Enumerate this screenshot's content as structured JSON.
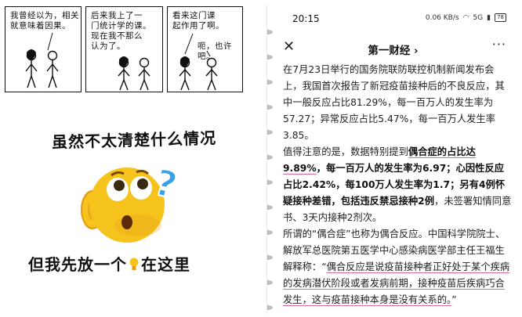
{
  "comic": {
    "panel1_line1": "我曾经以为，相关",
    "panel1_line2": "就意味着因果。",
    "panel2_line1": "后来我上了一",
    "panel2_line2": "门统计学的课。",
    "panel2_line3": "现在我不那么",
    "panel2_line4": "认为了。",
    "panel3_line1": "看来这门课",
    "panel3_line2": "起作用了啊。",
    "panel3_reply": "呃，也许吧。"
  },
  "meme": {
    "caption_top": "虽然不太清楚什么情况",
    "caption_bottom_a": "但我先放一个",
    "caption_bottom_b": "在这里"
  },
  "phone": {
    "status": {
      "time": "20:15",
      "speed": "0.06 KB/s",
      "signal": "5G",
      "battery": "78"
    },
    "nav": {
      "close_icon": "close-icon",
      "title": "第一财经 ›",
      "more": "···"
    },
    "article": {
      "p1": "在7月23日举行的国务院联防联控机制新闻发布会上，我国首次报告了新冠疫苗接种后的不良反应，其中一般反应占比81.29%，每一百万人的发生率为57.27；异常反应占比5.47%，每一百万人发生率3.85。",
      "p2_a": "值得注意的是，数据特别提到",
      "p2_b": "偶合症的占比达9.89%",
      "p2_c": "，每一百万人的发生率为6.97；心因性反应占比2.42%，每100万人发生率为1.7；另有4例怀疑接种差错，包括违反禁忌接种2例",
      "p2_d": "，未签署知情同意书、3天内接种2剂次。",
      "p3_a": "所谓的“偶合症”也称为偶合反应。中国科学院院士、解放军总医院第五医学中心感染病医学部主任王福生解释称：“",
      "p3_b": "偶合反应是说疫苗接种者正好处于某个疾病的发病潜伏阶段或者发病前期，接种疫苗后疾病巧合发生，这与疫苗接种本身是没有关系的。",
      "p3_c": "”"
    }
  },
  "colors": {
    "emoji_face": "#f6c21c",
    "emoji_shadow": "#e09a12",
    "question_mark": "#3aa0e8",
    "underline": "#e06a8c"
  }
}
